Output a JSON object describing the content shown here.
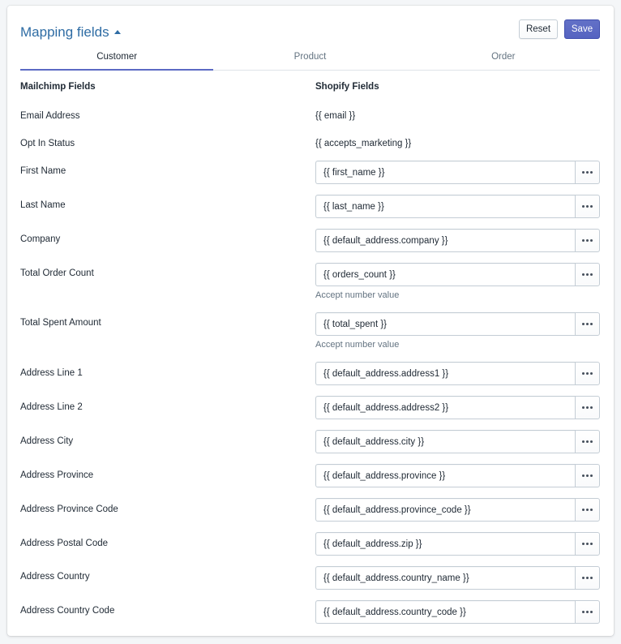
{
  "header": {
    "title": "Mapping fields",
    "reset_label": "Reset",
    "save_label": "Save"
  },
  "tabs": [
    {
      "label": "Customer",
      "active": true
    },
    {
      "label": "Product",
      "active": false
    },
    {
      "label": "Order",
      "active": false
    }
  ],
  "columns": {
    "left": "Mailchimp Fields",
    "right": "Shopify Fields"
  },
  "static_rows": [
    {
      "label": "Email Address",
      "value": "{{ email }}"
    },
    {
      "label": "Opt In Status",
      "value": "{{ accepts_marketing }}"
    }
  ],
  "fields": [
    {
      "label": "First Name",
      "value": "{{ first_name }}"
    },
    {
      "label": "Last Name",
      "value": "{{ last_name }}"
    },
    {
      "label": "Company",
      "value": "{{ default_address.company }}"
    },
    {
      "label": "Total Order Count",
      "value": "{{ orders_count }}",
      "hint": "Accept number value"
    },
    {
      "label": "Total Spent Amount",
      "value": "{{ total_spent }}",
      "hint": "Accept number value"
    },
    {
      "label": "Address Line 1",
      "value": "{{ default_address.address1 }}"
    },
    {
      "label": "Address Line 2",
      "value": "{{ default_address.address2 }}"
    },
    {
      "label": "Address City",
      "value": "{{ default_address.city }}"
    },
    {
      "label": "Address Province",
      "value": "{{ default_address.province }}"
    },
    {
      "label": "Address Province Code",
      "value": "{{ default_address.province_code }}"
    },
    {
      "label": "Address Postal Code",
      "value": "{{ default_address.zip }}"
    },
    {
      "label": "Address Country",
      "value": "{{ default_address.country_name }}"
    },
    {
      "label": "Address Country Code",
      "value": "{{ default_address.country_code }}"
    }
  ],
  "icons": {
    "title_caret": "caret-up-icon",
    "field_action": "ellipsis-icon"
  },
  "colors": {
    "accent": "#5c6ac4",
    "title": "#2e6ca4"
  }
}
